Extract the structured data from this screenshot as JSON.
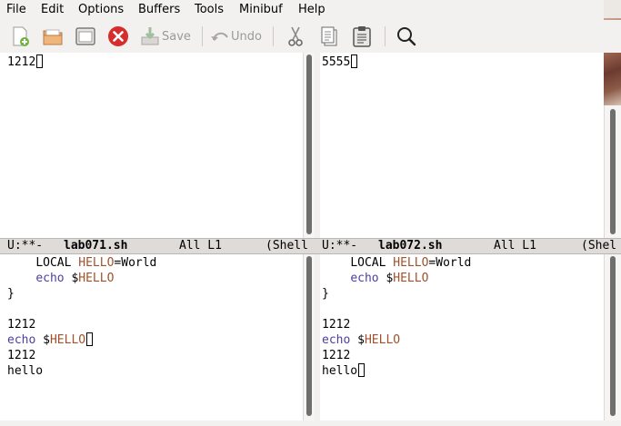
{
  "menubar": {
    "items": [
      "File",
      "Edit",
      "Options",
      "Buffers",
      "Tools",
      "Minibuf",
      "Help"
    ]
  },
  "toolbar": {
    "save_label": "Save",
    "undo_label": "Undo",
    "icons": [
      "new-file-icon",
      "open-folder-icon",
      "dired-icon",
      "close-buffer-icon",
      "save-icon",
      "undo-icon",
      "cut-icon",
      "copy-icon",
      "paste-icon",
      "search-icon"
    ],
    "colors": {
      "close": "#d62d2d",
      "disabled_text": "#9a9a9a"
    }
  },
  "windows": {
    "top_left": {
      "lines": [
        "1212"
      ]
    },
    "top_right": {
      "lines": [
        "5555"
      ]
    },
    "bottom_left": {
      "lines": [
        {
          "indent": "    ",
          "parts": [
            {
              "t": "LOCAL ",
              "c": ""
            },
            {
              "t": "HELLO",
              "c": "var"
            },
            {
              "t": "=World",
              "c": ""
            }
          ]
        },
        {
          "indent": "    ",
          "parts": [
            {
              "t": "echo",
              "c": "kw"
            },
            {
              "t": " $",
              "c": ""
            },
            {
              "t": "HELLO",
              "c": "var"
            }
          ]
        },
        {
          "indent": "",
          "parts": [
            {
              "t": "}",
              "c": ""
            }
          ]
        },
        {
          "indent": "",
          "parts": []
        },
        {
          "indent": "",
          "parts": [
            {
              "t": "1212",
              "c": ""
            }
          ]
        },
        {
          "indent": "",
          "parts": [
            {
              "t": "echo",
              "c": "kw"
            },
            {
              "t": " $",
              "c": ""
            },
            {
              "t": "HELLO",
              "c": "var"
            }
          ],
          "cursor": true
        },
        {
          "indent": "",
          "parts": [
            {
              "t": "1212",
              "c": ""
            }
          ]
        },
        {
          "indent": "",
          "parts": [
            {
              "t": "hello",
              "c": ""
            }
          ]
        }
      ]
    },
    "bottom_right": {
      "lines": [
        {
          "indent": "    ",
          "parts": [
            {
              "t": "LOCAL ",
              "c": ""
            },
            {
              "t": "HELLO",
              "c": "var"
            },
            {
              "t": "=World",
              "c": ""
            }
          ]
        },
        {
          "indent": "    ",
          "parts": [
            {
              "t": "echo",
              "c": "kw"
            },
            {
              "t": " $",
              "c": ""
            },
            {
              "t": "HELLO",
              "c": "var"
            }
          ]
        },
        {
          "indent": "",
          "parts": [
            {
              "t": "}",
              "c": ""
            }
          ]
        },
        {
          "indent": "",
          "parts": []
        },
        {
          "indent": "",
          "parts": [
            {
              "t": "1212",
              "c": ""
            }
          ]
        },
        {
          "indent": "",
          "parts": [
            {
              "t": "echo",
              "c": "kw"
            },
            {
              "t": " $",
              "c": ""
            },
            {
              "t": "HELLO",
              "c": "var"
            }
          ]
        },
        {
          "indent": "",
          "parts": [
            {
              "t": "1212",
              "c": ""
            }
          ]
        },
        {
          "indent": "",
          "parts": [
            {
              "t": "hello",
              "c": ""
            }
          ],
          "cursor": true
        }
      ]
    }
  },
  "modelines": {
    "left": {
      "status": "U:**-",
      "buffer": "lab071.sh",
      "position": "All L1",
      "mode": "(Shell"
    },
    "right": {
      "status": "U:**-",
      "buffer": "lab072.sh",
      "position": "All L1",
      "mode": "(Shel"
    }
  },
  "syntax_colors": {
    "keyword": "#4b3fa0",
    "variable": "#a0522d"
  }
}
